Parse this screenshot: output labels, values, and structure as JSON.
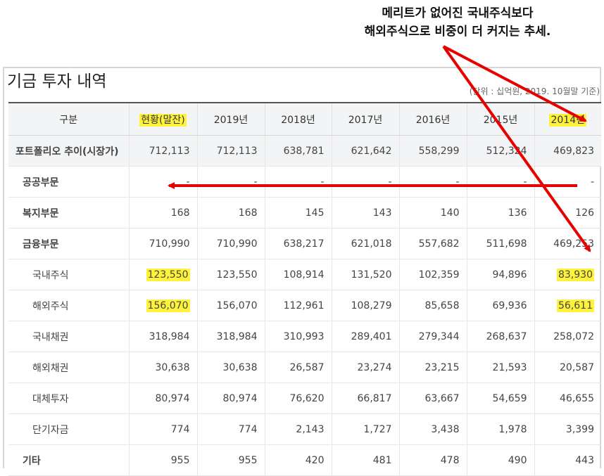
{
  "annotation": {
    "line1": "메리트가 없어진 국내주식보다",
    "line2": "해외주식으로 비중이 더 커지는 추세."
  },
  "title": "기금 투자 내역",
  "unit_note": "(단위 : 십억원, 2019. 10월말 기준)",
  "table": {
    "headers": [
      "구분",
      "현황(말잔)",
      "2019년",
      "2018년",
      "2017년",
      "2016년",
      "2015년",
      "2014년"
    ],
    "rows": [
      {
        "label": "포트폴리오 추이(시장가)",
        "values": [
          "712,113",
          "712,113",
          "638,781",
          "621,642",
          "558,299",
          "512,324",
          "469,823"
        ]
      },
      {
        "label": "공공부문",
        "values": [
          "-",
          "-",
          "-",
          "-",
          "-",
          "-",
          "-"
        ]
      },
      {
        "label": "복지부문",
        "values": [
          "168",
          "168",
          "145",
          "143",
          "140",
          "136",
          "126"
        ]
      },
      {
        "label": "금융부문",
        "values": [
          "710,990",
          "710,990",
          "638,217",
          "621,018",
          "557,682",
          "511,698",
          "469,253"
        ]
      },
      {
        "label": "국내주식",
        "values": [
          "123,550",
          "123,550",
          "108,914",
          "131,520",
          "102,359",
          "94,896",
          "83,930"
        ]
      },
      {
        "label": "해외주식",
        "values": [
          "156,070",
          "156,070",
          "112,961",
          "108,279",
          "85,658",
          "69,936",
          "56,611"
        ]
      },
      {
        "label": "국내채권",
        "values": [
          "318,984",
          "318,984",
          "310,993",
          "289,401",
          "279,344",
          "268,637",
          "258,072"
        ]
      },
      {
        "label": "해외채권",
        "values": [
          "30,638",
          "30,638",
          "26,587",
          "23,274",
          "23,215",
          "21,593",
          "20,587"
        ]
      },
      {
        "label": "대체투자",
        "values": [
          "80,974",
          "80,974",
          "76,620",
          "66,817",
          "63,667",
          "54,659",
          "46,655"
        ]
      },
      {
        "label": "단기자금",
        "values": [
          "774",
          "774",
          "2,143",
          "1,727",
          "3,438",
          "1,978",
          "3,399"
        ]
      },
      {
        "label": "기타",
        "values": [
          "955",
          "955",
          "420",
          "481",
          "478",
          "490",
          "443"
        ]
      }
    ]
  },
  "colors": {
    "highlight": "#fff23a",
    "arrow": "#e60000"
  }
}
